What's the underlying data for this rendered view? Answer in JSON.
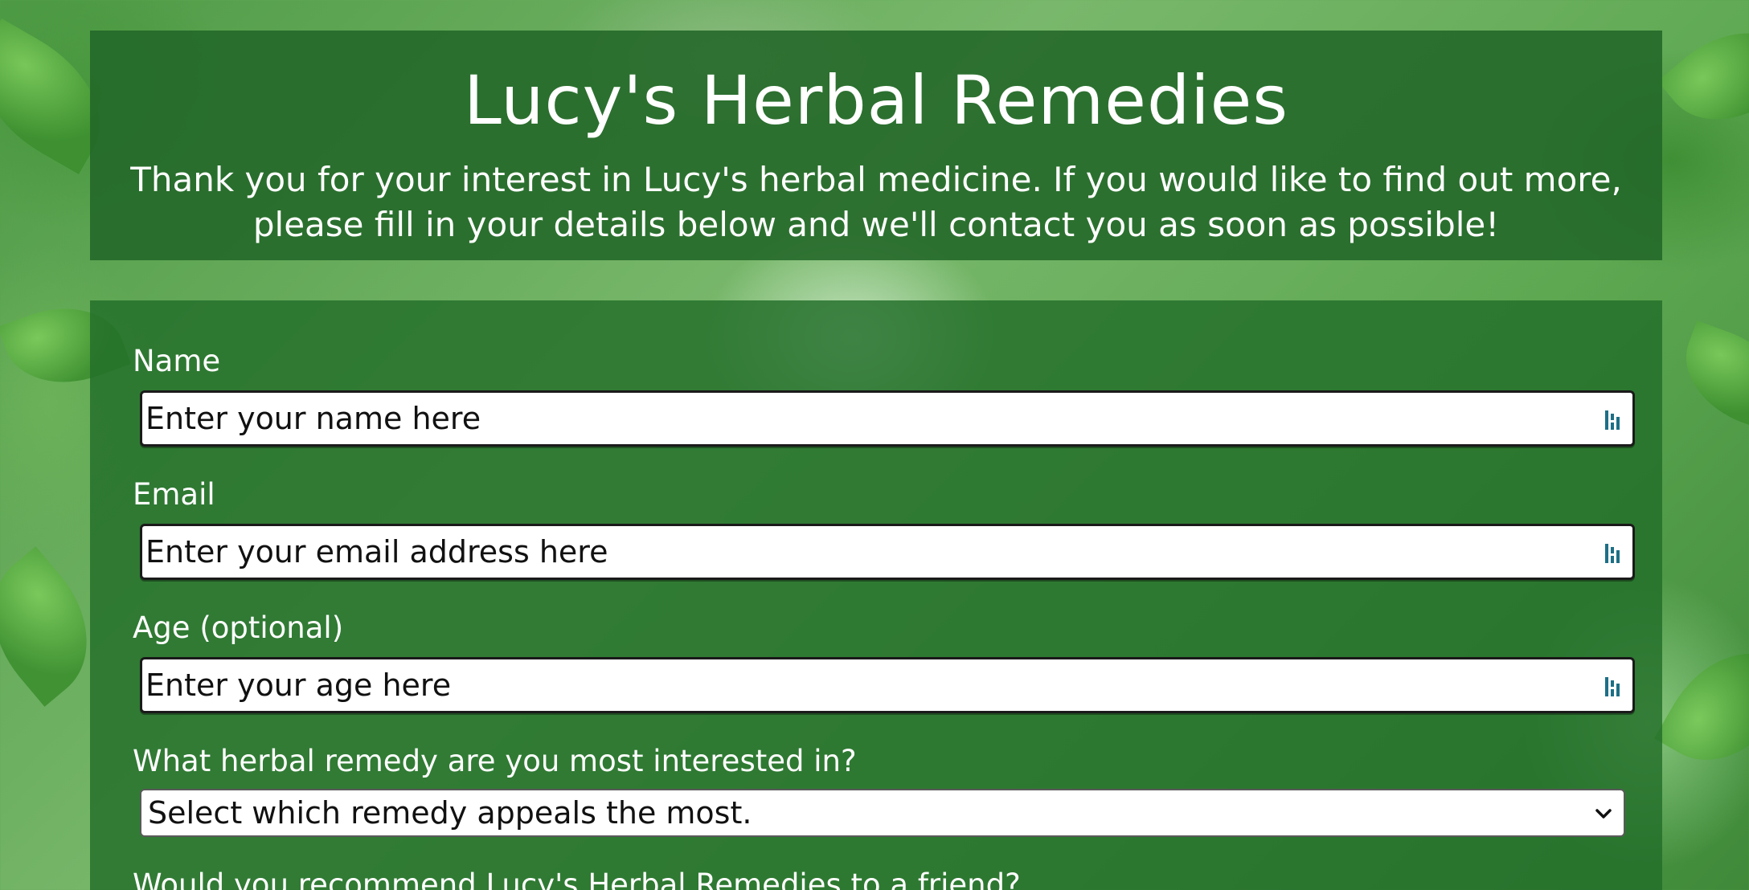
{
  "header": {
    "title": "Lucy's Herbal Remedies",
    "description": "Thank you for your interest in Lucy's herbal medicine. If you would like to find out more, please fill in your details below and we'll contact you as soon as possible!"
  },
  "form": {
    "name": {
      "label": "Name",
      "placeholder": "Enter your name here",
      "value": ""
    },
    "email": {
      "label": "Email",
      "placeholder": "Enter your email address here",
      "value": ""
    },
    "age": {
      "label": "Age (optional)",
      "placeholder": "Enter your age here",
      "value": ""
    },
    "remedy": {
      "label": "What herbal remedy are you most interested in?",
      "selected": "Select which remedy appeals the most."
    },
    "recommend": {
      "label": "Would you recommend Lucy's Herbal Remedies to a friend?"
    }
  },
  "icons": {
    "field_autofill": "password-manager-key-icon",
    "select_arrow": "chevron-down-icon"
  },
  "colors": {
    "panel_green": "#226628",
    "text_white": "#ffffff",
    "icon_teal": "#1d6f86"
  }
}
